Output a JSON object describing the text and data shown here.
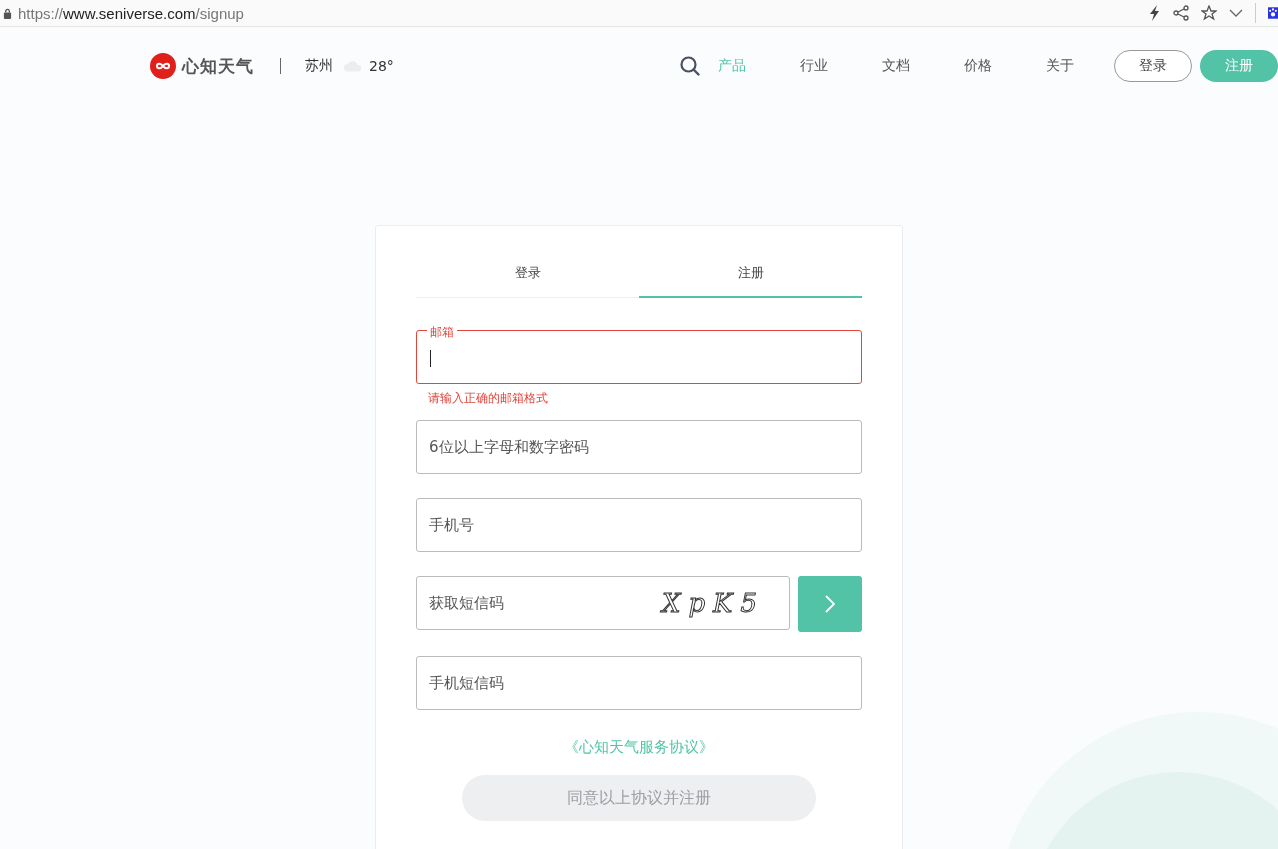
{
  "browser": {
    "url_scheme": "https://",
    "url_host": "www.seniverse.com",
    "url_path": "/signup"
  },
  "header": {
    "brand": "心知天气",
    "city": "苏州",
    "temperature": "28°",
    "nav": [
      {
        "label": "产品",
        "selected": true
      },
      {
        "label": "行业",
        "selected": false
      },
      {
        "label": "文档",
        "selected": false
      },
      {
        "label": "价格",
        "selected": false
      },
      {
        "label": "关于",
        "selected": false
      }
    ],
    "login_button": "登录",
    "signup_button": "注册"
  },
  "form": {
    "tabs": [
      {
        "label": "登录",
        "selected": false
      },
      {
        "label": "注册",
        "selected": true
      }
    ],
    "fields": [
      {
        "kind": "text",
        "label": "邮箱",
        "focused": true,
        "error": "请输入正确的邮箱格式"
      },
      {
        "kind": "text",
        "placeholder": "6位以上字母和数字密码",
        "focused": false
      },
      {
        "kind": "text",
        "placeholder": "手机号",
        "focused": false
      },
      {
        "kind": "captcha",
        "placeholder": "获取短信码",
        "captcha": "XpK5",
        "focused": false
      },
      {
        "kind": "text",
        "placeholder": "手机短信码",
        "focused": false
      }
    ],
    "agreement_link": "《心知天气服务协议》",
    "submit": {
      "label": "同意以上协议并注册",
      "disabled": true
    }
  }
}
